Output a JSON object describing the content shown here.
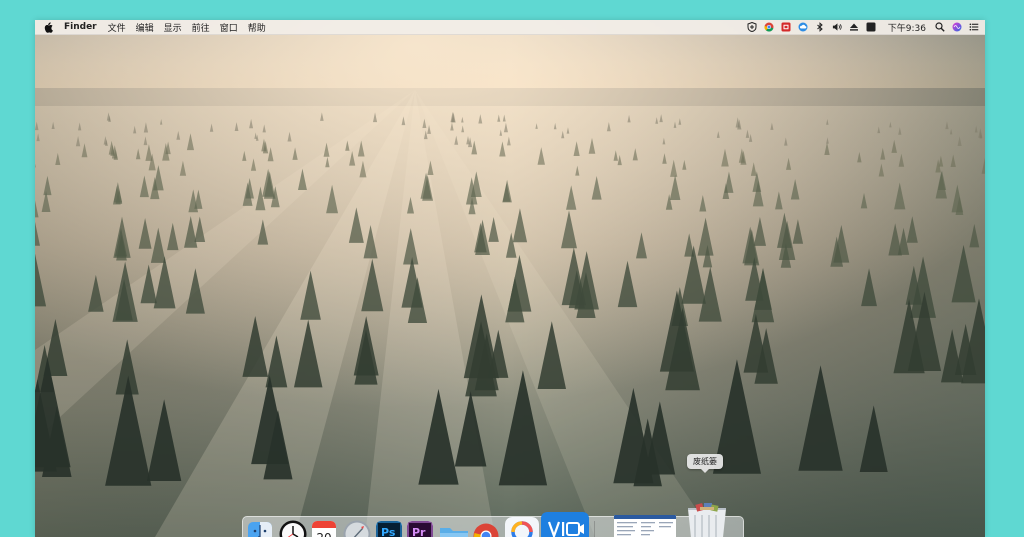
{
  "menubar": {
    "apple_icon": "apple-icon",
    "app_name": "Finder",
    "items": [
      "文件",
      "编辑",
      "显示",
      "前往",
      "窗口",
      "帮助"
    ],
    "status_icons": [
      "shield-icon",
      "chrome-icon",
      "red-app-icon",
      "cloud-icon",
      "bluetooth-icon",
      "volume-icon",
      "eject-icon",
      "dark-square-icon"
    ],
    "clock": "下午9:36",
    "right_icons": [
      "search-icon",
      "siri-icon",
      "notification-list-icon"
    ]
  },
  "dock": {
    "tooltip": "废纸篓",
    "apps": [
      "finder",
      "clock",
      "calendar",
      "rocket",
      "photoshop",
      "premiere",
      "folder",
      "chrome",
      "pinwheel",
      "video",
      "document-window",
      "trash"
    ],
    "calendar_day": "20",
    "ps_label": "Ps",
    "pr_label": "Pr"
  },
  "colors": {
    "background": "#5fd8d2",
    "sky_top": "#c6bfb6",
    "sky_glow": "#f6dcba",
    "forest_dark": "#3a4236"
  }
}
